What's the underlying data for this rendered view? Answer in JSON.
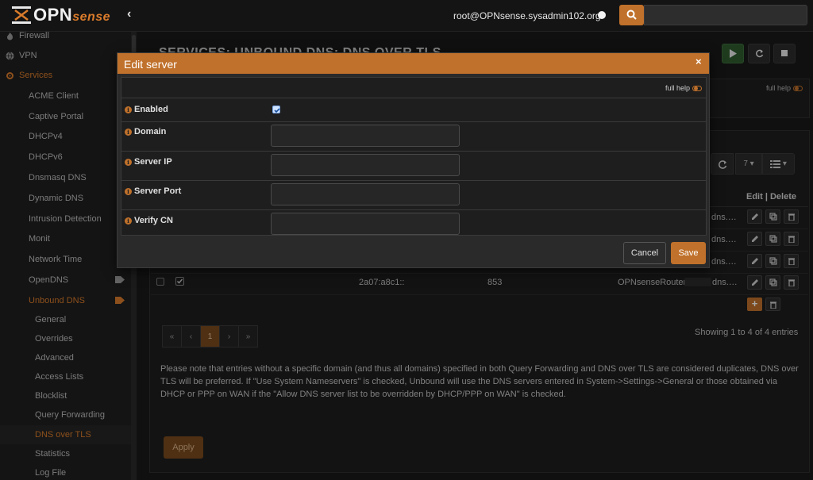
{
  "header": {
    "brand_main": "OPN",
    "brand_accent": "sense",
    "user": "root@OPNsense.sysadmin102.org"
  },
  "sidebar": {
    "items": [
      {
        "label": "Firewall",
        "icon": "fire-icon"
      },
      {
        "label": "VPN",
        "icon": "globe-icon"
      },
      {
        "label": "Services",
        "icon": "gear-icon"
      },
      {
        "label": "ACME Client"
      },
      {
        "label": "Captive Portal"
      },
      {
        "label": "DHCPv4"
      },
      {
        "label": "DHCPv6"
      },
      {
        "label": "Dnsmasq DNS"
      },
      {
        "label": "Dynamic DNS"
      },
      {
        "label": "Intrusion Detection"
      },
      {
        "label": "Monit"
      },
      {
        "label": "Network Time"
      },
      {
        "label": "OpenDNS"
      },
      {
        "label": "Unbound DNS"
      },
      {
        "label": "General"
      },
      {
        "label": "Overrides"
      },
      {
        "label": "Advanced"
      },
      {
        "label": "Access Lists"
      },
      {
        "label": "Blocklist"
      },
      {
        "label": "Query Forwarding"
      },
      {
        "label": "DNS over TLS"
      },
      {
        "label": "Statistics"
      },
      {
        "label": "Log File"
      }
    ]
  },
  "page": {
    "title": "SERVICES: UNBOUND DNS: DNS OVER TLS",
    "full_help": "full help",
    "grid": {
      "page_size": "7",
      "col_edit_delete": "Edit | Delete",
      "rows": [
        {
          "server": "dns.…"
        },
        {
          "server": "dns.…"
        },
        {
          "server": "dns.…"
        },
        {
          "ip": "2a07:a8c1::",
          "port": "853",
          "server_prefix": "OPNsenseRouter-",
          "server": "dns.…"
        }
      ],
      "pager": [
        "«",
        "‹",
        "1",
        "›",
        "»"
      ],
      "showing": "Showing 1 to 4 of 4 entries"
    },
    "note": "Please note that entries without a specific domain (and thus all domains) specified in both Query Forwarding and DNS over TLS are considered duplicates, DNS over TLS will be preferred. If \"Use System Nameservers\" is checked, Unbound will use the DNS servers entered in System->Settings->General or those obtained via DHCP or PPP on WAN if the \"Allow DNS server list to be overridden by DHCP/PPP on WAN\" is checked.",
    "apply": "Apply"
  },
  "modal": {
    "title": "Edit server",
    "close": "×",
    "full_help": "full help",
    "fields": {
      "enabled": "Enabled",
      "domain": "Domain",
      "server_ip": "Server IP",
      "server_port": "Server Port",
      "verify_cn": "Verify CN"
    },
    "cancel": "Cancel",
    "save": "Save"
  },
  "colors": {
    "accent": "#c0712b",
    "background": "#1a1a1a"
  }
}
